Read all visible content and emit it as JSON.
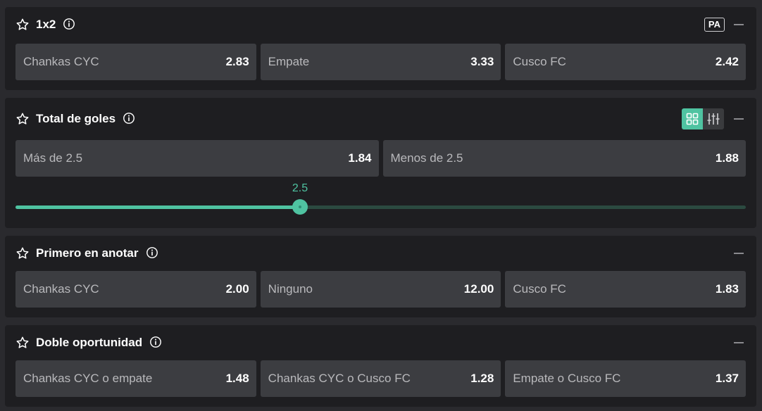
{
  "markets": [
    {
      "title": "1x2",
      "badge": "PA",
      "options": [
        {
          "label": "Chankas CYC",
          "odds": "2.83"
        },
        {
          "label": "Empate",
          "odds": "3.33"
        },
        {
          "label": "Cusco FC",
          "odds": "2.42"
        }
      ]
    },
    {
      "title": "Total de goles",
      "view_toggle": [
        "grid-view-icon",
        "slider-view-icon"
      ],
      "options": [
        {
          "label": "Más de 2.5",
          "odds": "1.84"
        },
        {
          "label": "Menos de 2.5",
          "odds": "1.88"
        }
      ],
      "slider": {
        "value_label": "2.5",
        "fraction": 0.39
      }
    },
    {
      "title": "Primero en anotar",
      "options": [
        {
          "label": "Chankas CYC",
          "odds": "2.00"
        },
        {
          "label": "Ninguno",
          "odds": "12.00"
        },
        {
          "label": "Cusco FC",
          "odds": "1.83"
        }
      ]
    },
    {
      "title": "Doble oportunidad",
      "options": [
        {
          "label": "Chankas CYC o empate",
          "odds": "1.48"
        },
        {
          "label": "Chankas CYC o Cusco FC",
          "odds": "1.28"
        },
        {
          "label": "Empate o Cusco FC",
          "odds": "1.37"
        }
      ]
    }
  ],
  "colors": {
    "accent": "#4fc3a1",
    "panel": "#1e1e21",
    "odds_button": "#3c3d41",
    "background": "#2a2a2e"
  }
}
